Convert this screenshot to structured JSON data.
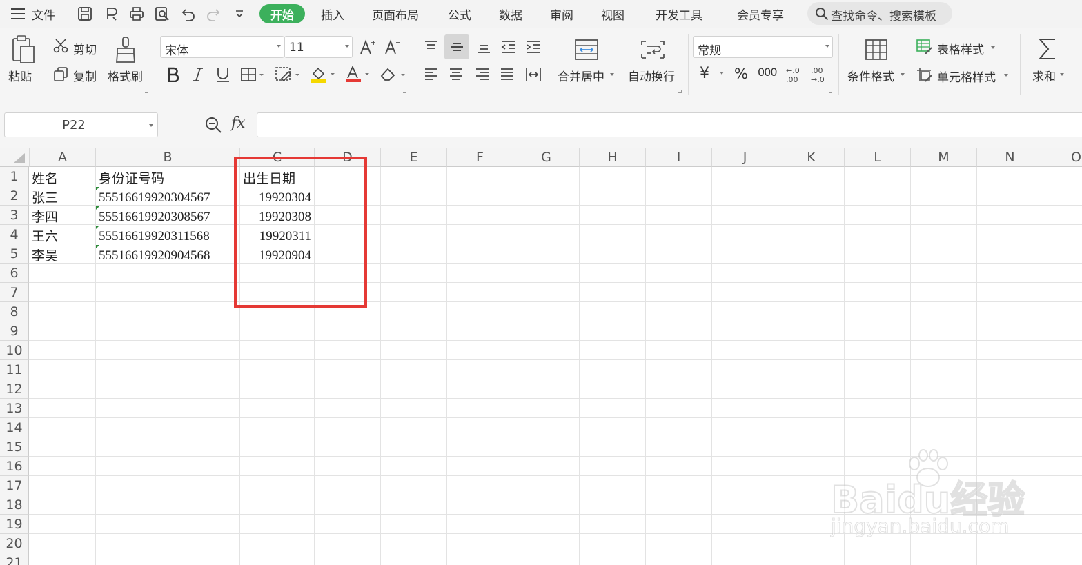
{
  "menubar": {
    "file_label": "文件",
    "tabs": [
      {
        "label": "开始",
        "active": true
      },
      {
        "label": "插入"
      },
      {
        "label": "页面布局"
      },
      {
        "label": "公式"
      },
      {
        "label": "数据"
      },
      {
        "label": "审阅"
      },
      {
        "label": "视图"
      },
      {
        "label": "开发工具"
      },
      {
        "label": "会员专享"
      }
    ],
    "search_placeholder": "查找命令、搜索模板",
    "active_color": "#3cb05c"
  },
  "ribbon": {
    "paste": "粘贴",
    "cut": "剪切",
    "copy": "复制",
    "format_painter": "格式刷",
    "font_name": "宋体",
    "font_size": "11",
    "merge_center": "合并居中",
    "wrap_text": "自动换行",
    "number_format": "常规",
    "currency_symbol": "¥",
    "percent_symbol": "%",
    "thousands_symbol": "000",
    "conditional_format": "条件格式",
    "table_style": "表格样式",
    "cell_style": "单元格样式",
    "sum": "求和"
  },
  "formula_bar": {
    "name_box": "P22",
    "fx_label": "fx",
    "formula": ""
  },
  "sheet": {
    "columns": [
      "A",
      "B",
      "C",
      "D",
      "E",
      "F",
      "G",
      "H",
      "I",
      "J",
      "K",
      "L",
      "M",
      "N",
      "O"
    ],
    "rows": [
      "1",
      "2",
      "3",
      "4",
      "5",
      "6",
      "7",
      "8",
      "9",
      "10",
      "11",
      "12",
      "13",
      "14",
      "15",
      "16",
      "17",
      "18",
      "19",
      "20",
      "21"
    ],
    "cells": [
      {
        "ref": "A1",
        "value": "姓名"
      },
      {
        "ref": "B1",
        "value": "身份证号码"
      },
      {
        "ref": "C1",
        "value": "出生日期"
      },
      {
        "ref": "A2",
        "value": "张三"
      },
      {
        "ref": "B2",
        "value": "55516619920304567"
      },
      {
        "ref": "C2",
        "value": "19920304"
      },
      {
        "ref": "A3",
        "value": "李四"
      },
      {
        "ref": "B3",
        "value": "55516619920308567"
      },
      {
        "ref": "C3",
        "value": "19920308"
      },
      {
        "ref": "A4",
        "value": "王六"
      },
      {
        "ref": "B4",
        "value": "55516619920311568"
      },
      {
        "ref": "C4",
        "value": "19920311"
      },
      {
        "ref": "A5",
        "value": "李吴"
      },
      {
        "ref": "B5",
        "value": "55516619920904568"
      },
      {
        "ref": "C5",
        "value": "19920904"
      }
    ],
    "highlight_color": "#e53935"
  },
  "watermark": {
    "logo_text": "Baidu经验",
    "url_text": "jingyan.baidu.com"
  }
}
